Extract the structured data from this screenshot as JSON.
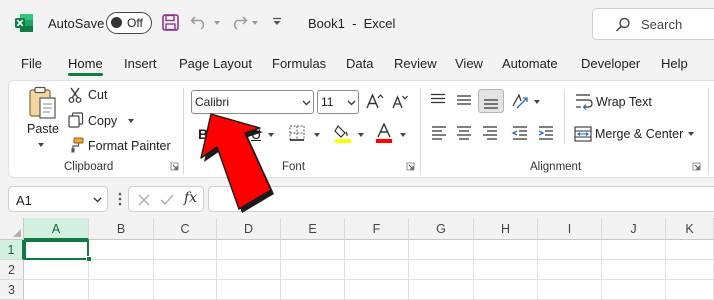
{
  "titlebar": {
    "autosave_label": "AutoSave",
    "toggle_state": "Off",
    "document_title": "Book1  -  Excel",
    "search_placeholder": "Search"
  },
  "tabs": [
    "File",
    "Home",
    "Insert",
    "Page Layout",
    "Formulas",
    "Data",
    "Review",
    "View",
    "Automate",
    "Developer",
    "Help"
  ],
  "active_tab": "Home",
  "ribbon": {
    "clipboard": {
      "paste": "Paste",
      "cut": "Cut",
      "copy": "Copy",
      "format_painter": "Format Painter",
      "group_label": "Clipboard"
    },
    "font": {
      "font_name": "Calibri",
      "font_size": "11",
      "bold": "B",
      "underline": "U",
      "group_label": "Font"
    },
    "alignment": {
      "wrap_text": "Wrap Text",
      "merge_center": "Merge & Center",
      "group_label": "Alignment"
    }
  },
  "formula_bar": {
    "name_box": "A1",
    "fx": "fx",
    "formula": ""
  },
  "grid": {
    "columns": [
      "A",
      "B",
      "C",
      "D",
      "E",
      "F",
      "G",
      "H",
      "I",
      "J",
      "K"
    ],
    "rows": [
      "1",
      "2",
      "3"
    ],
    "active_cell": "A1"
  },
  "colors": {
    "excel_green": "#107c41",
    "annotation_arrow": "#ff0000",
    "font_color_bar": "#ff0000",
    "highlight_bar": "#ffff00"
  }
}
